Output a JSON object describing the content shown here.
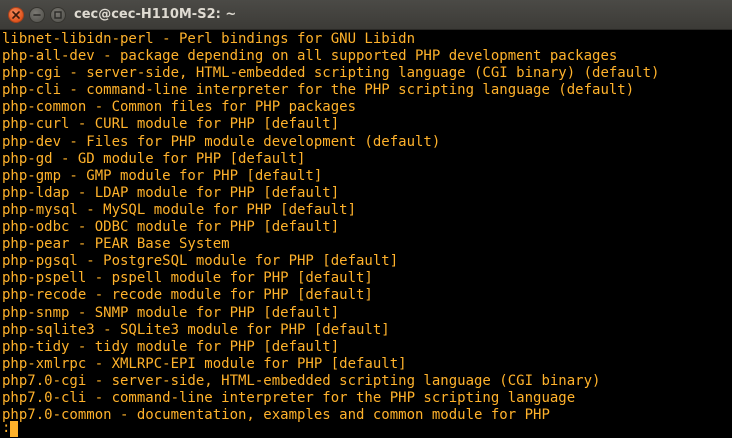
{
  "window": {
    "title": "cec@cec-H110M-S2: ~"
  },
  "icons": {
    "close": "close-icon",
    "minimize": "minimize-icon",
    "maximize": "maximize-icon"
  },
  "colors": {
    "terminal_background": "#000000",
    "terminal_text": "#ffb22b",
    "close_button": "#e0551e",
    "titlebar": "#3c3b37"
  },
  "terminal": {
    "lines": [
      "libnet-libidn-perl - Perl bindings for GNU Libidn",
      "php-all-dev - package depending on all supported PHP development packages",
      "php-cgi - server-side, HTML-embedded scripting language (CGI binary) (default)",
      "php-cli - command-line interpreter for the PHP scripting language (default)",
      "php-common - Common files for PHP packages",
      "php-curl - CURL module for PHP [default]",
      "php-dev - Files for PHP module development (default)",
      "php-gd - GD module for PHP [default]",
      "php-gmp - GMP module for PHP [default]",
      "php-ldap - LDAP module for PHP [default]",
      "php-mysql - MySQL module for PHP [default]",
      "php-odbc - ODBC module for PHP [default]",
      "php-pear - PEAR Base System",
      "php-pgsql - PostgreSQL module for PHP [default]",
      "php-pspell - pspell module for PHP [default]",
      "php-recode - recode module for PHP [default]",
      "php-snmp - SNMP module for PHP [default]",
      "php-sqlite3 - SQLite3 module for PHP [default]",
      "php-tidy - tidy module for PHP [default]",
      "php-xmlrpc - XMLRPC-EPI module for PHP [default]",
      "php7.0-cgi - server-side, HTML-embedded scripting language (CGI binary)",
      "php7.0-cli - command-line interpreter for the PHP scripting language",
      "php7.0-common - documentation, examples and common module for PHP"
    ],
    "prompt": ":"
  }
}
